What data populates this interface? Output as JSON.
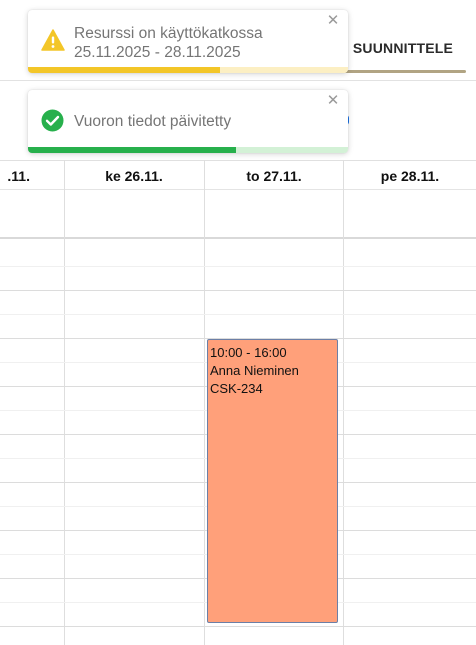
{
  "toolbar": {
    "plan_label": "SUUNNITTELE"
  },
  "toasts": {
    "warning": {
      "line1": "Resurssi on käyttökatkossa",
      "line2": "25.11.2025 - 28.11.2025",
      "close": "✕",
      "progress": 0.6,
      "icon": "warning-icon",
      "color": "#f3c628"
    },
    "success": {
      "message": "Vuoron tiedot päivitetty",
      "close": "✕",
      "progress": 0.65,
      "icon": "check-circle-icon",
      "color": "#27b04c"
    }
  },
  "calendar": {
    "days": [
      ".11.",
      "ke 26.11.",
      "to 27.11.",
      "pe 28.11."
    ]
  },
  "event": {
    "time": "10:00 - 16:00",
    "person": "Anna Nieminen",
    "code": "CSK-234",
    "color": "#ffa07a"
  }
}
